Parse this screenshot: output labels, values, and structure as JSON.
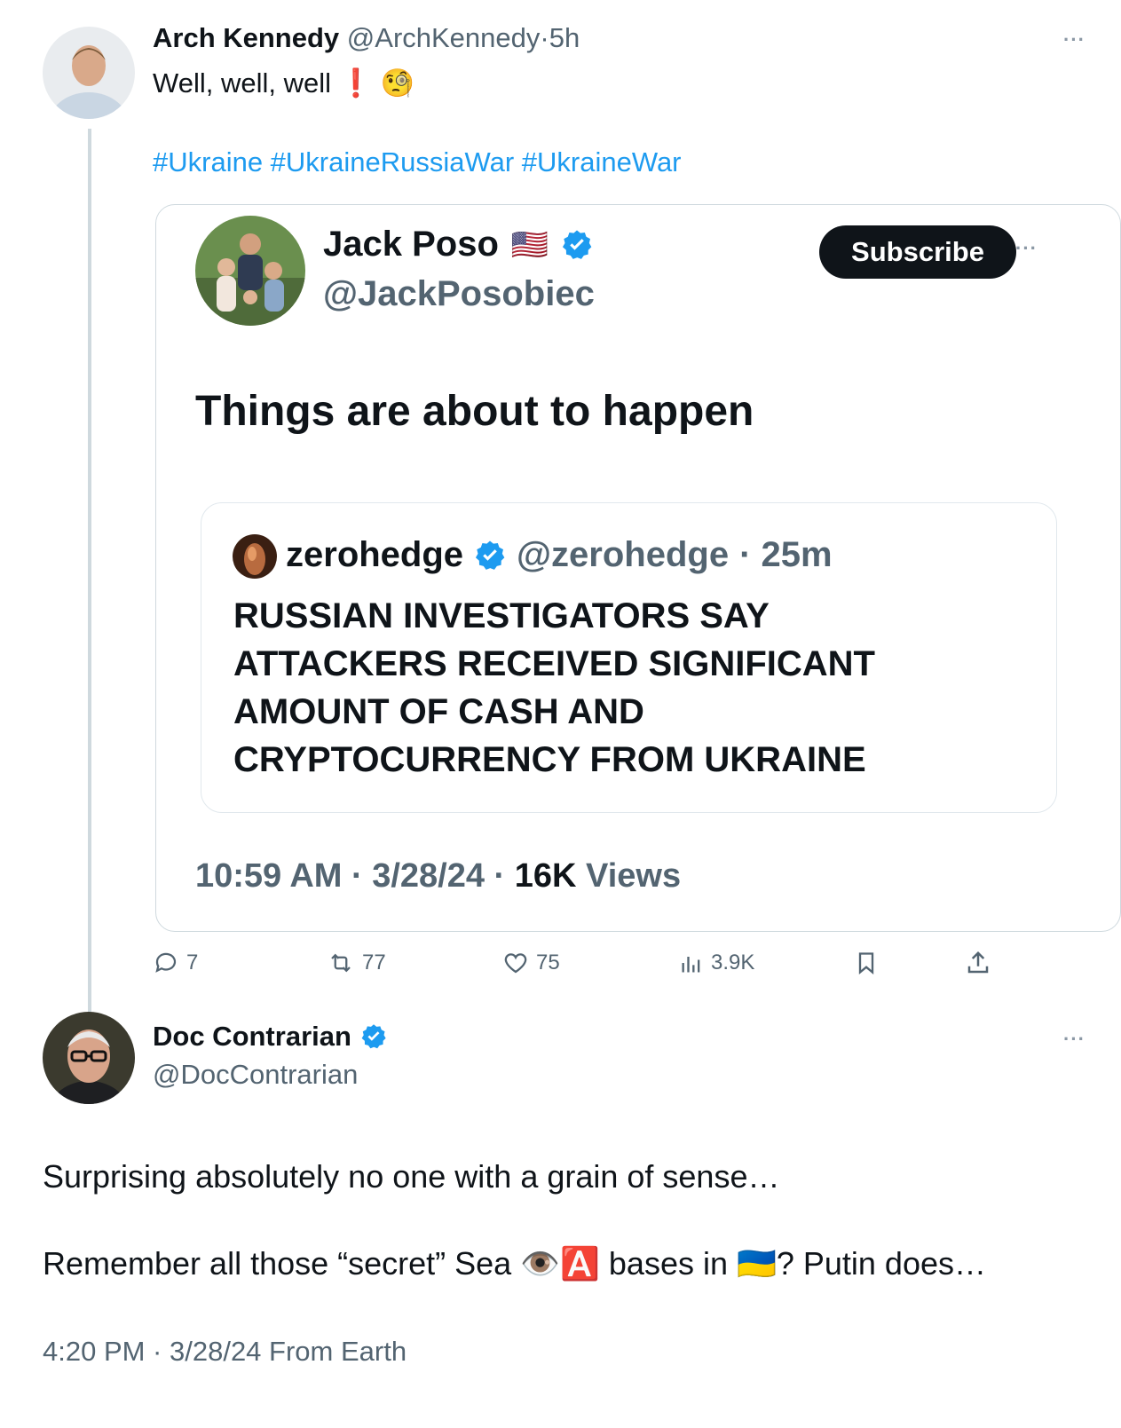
{
  "main_post": {
    "author_name": "Arch Kennedy",
    "handle": "@ArchKennedy",
    "separator": "·",
    "time": "5h",
    "text": "Well, well, well",
    "emoji": "❗ 🧐",
    "hashtags": "#Ukraine #UkraineRussiaWar #UkraineWar",
    "more_icon": "more-horizontal-icon"
  },
  "quoted_post": {
    "author_name": "Jack Poso",
    "flag": "🇺🇸",
    "handle": "@JackPosobiec",
    "subscribe_label": "Subscribe",
    "text": "Things are about to happen",
    "timestamp": "10:59 AM · 3/28/24 · ",
    "views_count": "16K",
    "views_label": " Views",
    "nested": {
      "author_name": "zerohedge",
      "handle": "@zerohedge",
      "time": "· 25m",
      "lines": [
        "RUSSIAN INVESTIGATORS SAY",
        "ATTACKERS RECEIVED SIGNIFICANT",
        "AMOUNT OF CASH AND",
        "CRYPTOCURRENCY FROM UKRAINE"
      ]
    }
  },
  "actions": {
    "replies": "7",
    "reposts": "77",
    "likes": "75",
    "views": "3.9K"
  },
  "reply_post": {
    "author_name": "Doc Contrarian",
    "handle": "@DocContrarian",
    "text1": "Surprising absolutely no one with a grain of sense…",
    "text2_a": "Remember all those “secret” Sea",
    "text2_emoji": "👁️🅰️",
    "text2_b": "bases in",
    "text2_flag": "🇺🇦",
    "text2_c": "? Putin does…",
    "footer": "4:20 PM · 3/28/24 From Earth"
  },
  "colors": {
    "accent": "#1d9bf0",
    "text": "#0f1419",
    "muted": "#536471",
    "border": "#cfd9de"
  }
}
